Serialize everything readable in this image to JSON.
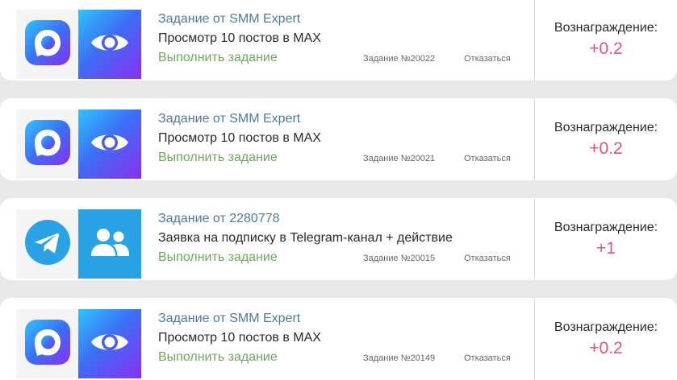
{
  "colors": {
    "from_link": "#4a7ba6",
    "do_task": "#6aaa5a",
    "reward": "#e0547c",
    "telegram": "#2aa3e6"
  },
  "tasks": [
    {
      "platform_icon": "max-messenger-icon",
      "action_icon": "eye-icon",
      "from": "Задание от SMM Expert",
      "title": "Просмотр 10 постов в MAX",
      "do_label": "Выполнить задание",
      "task_number": "Задание №20022",
      "decline_label": "Отказаться",
      "reward_label": "Вознаграждение:",
      "reward_value": "+0.2"
    },
    {
      "platform_icon": "max-messenger-icon",
      "action_icon": "eye-icon",
      "from": "Задание от SMM Expert",
      "title": "Просмотр 10 постов в MAX",
      "do_label": "Выполнить задание",
      "task_number": "Задание №20021",
      "decline_label": "Отказаться",
      "reward_label": "Вознаграждение:",
      "reward_value": "+0.2"
    },
    {
      "platform_icon": "telegram-icon",
      "action_icon": "users-icon",
      "from": "Задание от 2280778",
      "title": "Заявка на подписку в Telegram-канал + действие",
      "do_label": "Выполнить задание",
      "task_number": "Задание №20015",
      "decline_label": "Отказаться",
      "reward_label": "Вознаграждение:",
      "reward_value": "+1"
    },
    {
      "platform_icon": "max-messenger-icon",
      "action_icon": "eye-icon",
      "from": "Задание от SMM Expert",
      "title": "Просмотр 10 постов в MAX",
      "do_label": "Выполнить задание",
      "task_number": "Задание №20149",
      "decline_label": "Отказаться",
      "reward_label": "Вознаграждение:",
      "reward_value": "+0.2"
    }
  ]
}
